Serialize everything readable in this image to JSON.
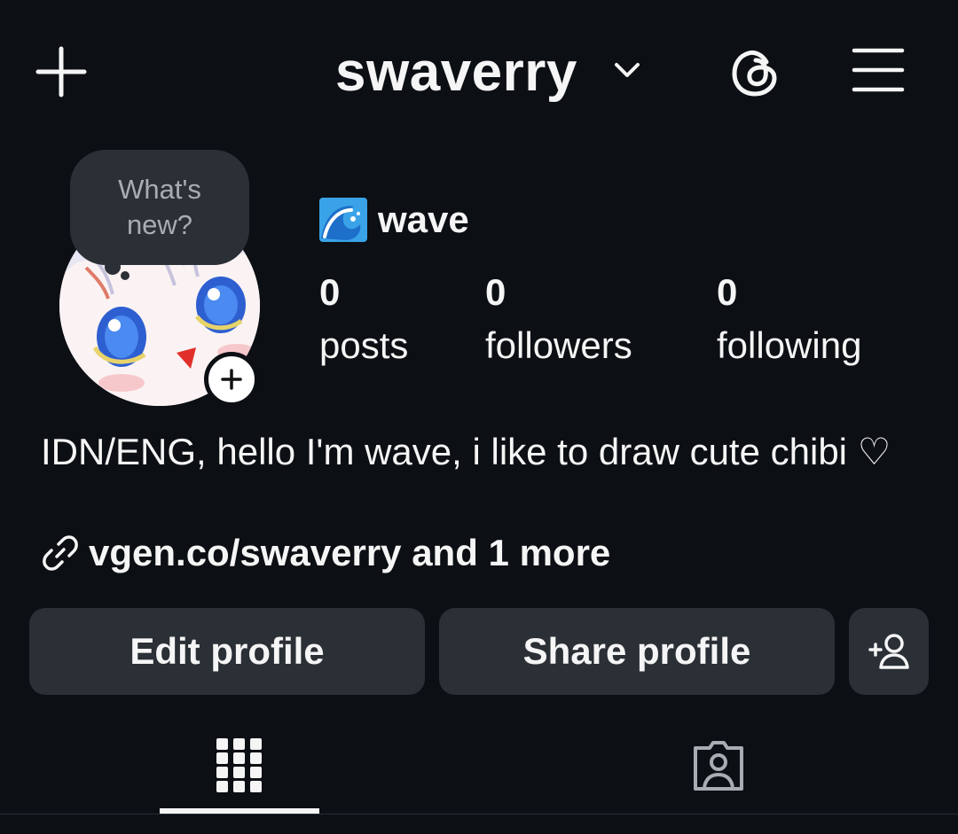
{
  "header": {
    "username": "swaverry",
    "icons": [
      "plus-icon",
      "chevron-down-icon",
      "threads-icon",
      "hamburger-menu-icon"
    ]
  },
  "note": {
    "text": "What's new?"
  },
  "profile": {
    "display_name": "wave",
    "display_emoji": "water-wave-emoji",
    "stats": [
      {
        "value": "0",
        "label": "posts"
      },
      {
        "value": "0",
        "label": "followers"
      },
      {
        "value": "0",
        "label": "following"
      }
    ],
    "bio": "IDN/ENG, hello I'm wave, i like to draw cute chibi ♡",
    "link_text": "vgen.co/swaverry and 1 more"
  },
  "actions": {
    "edit_label": "Edit profile",
    "share_label": "Share profile"
  },
  "tabs": [
    {
      "name": "grid",
      "icon": "grid-icon",
      "active": true
    },
    {
      "name": "tagged",
      "icon": "tagged-person-icon",
      "active": false
    }
  ],
  "colors": {
    "background": "#0c0f14",
    "button_bg": "#2b2f36",
    "text": "#f5f5f5",
    "muted": "#a8acb3"
  }
}
